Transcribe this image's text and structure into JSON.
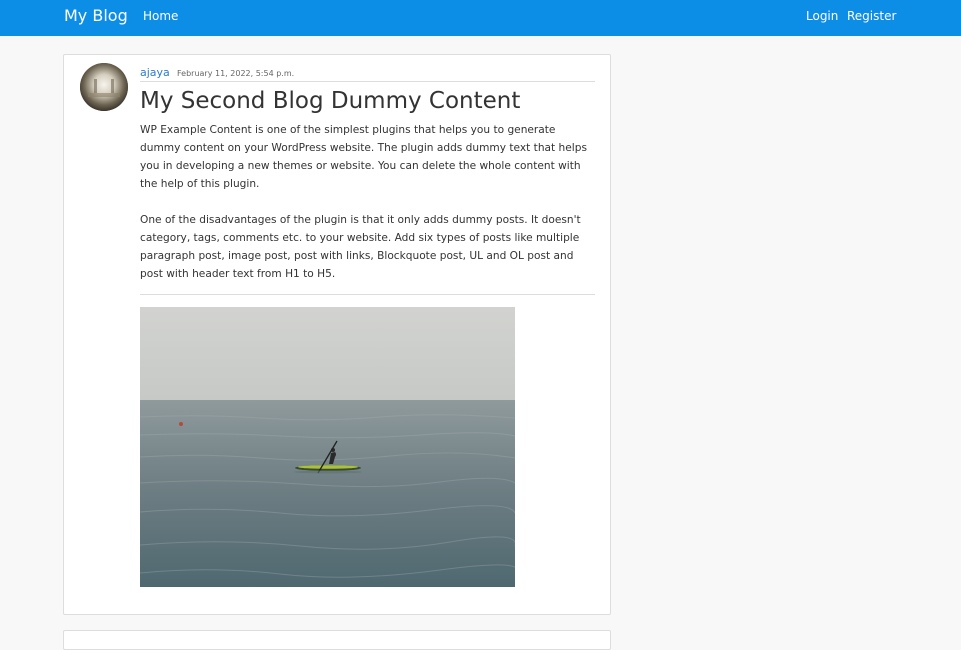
{
  "nav": {
    "brand": "My Blog",
    "home": "Home",
    "login": "Login",
    "register": "Register"
  },
  "post": {
    "author": "ajaya",
    "date": "February 11, 2022, 5:54 p.m.",
    "title": "My Second Blog Dummy Content",
    "paragraphs": [
      "WP Example Content is one of the simplest plugins that helps you to generate dummy content on your WordPress website. The plugin adds dummy text that helps you in developing a new themes or website. You can delete the whole content with the help of this plugin.",
      "One of the disadvantages of the plugin is that it only adds dummy posts. It doesn't category, tags, comments etc. to your website. Add six types of posts like multiple paragraph post, image post, post with links, Blockquote post, UL and OL post and post with header text from H1 to H5."
    ]
  },
  "colors": {
    "navbar": "#0c8de6",
    "link": "#2e7bcf",
    "page_background": "#f8f8f8"
  },
  "icons": {
    "avatar": "author-avatar-photo",
    "post_image": "kayak-on-sea-photo"
  }
}
